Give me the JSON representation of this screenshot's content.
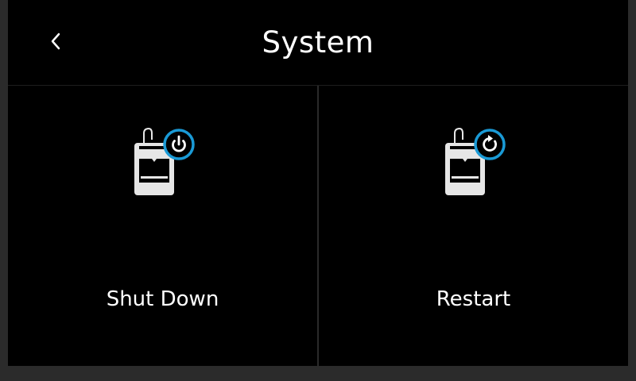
{
  "header": {
    "title": "System",
    "back_icon": "chevron-left-icon"
  },
  "tiles": [
    {
      "label": "Shut Down",
      "icon": "printer-power-icon"
    },
    {
      "label": "Restart",
      "icon": "printer-restart-icon"
    }
  ],
  "colors": {
    "background": "#000000",
    "text": "#ffffff",
    "accent": "#1a9ad6",
    "printer_body": "#e6e6e6",
    "frame": "#2b2b2b"
  }
}
